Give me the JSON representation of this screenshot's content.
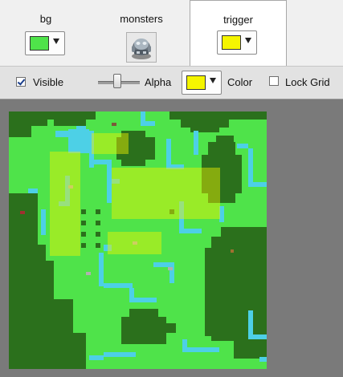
{
  "layers": {
    "tabs": [
      {
        "label": "bg",
        "swatch_color": "#4fe34a",
        "selected": false
      },
      {
        "label": "monsters",
        "icon": "monster-sprite-icon",
        "selected": false
      },
      {
        "label": "trigger",
        "swatch_color": "#f5f500",
        "selected": true
      }
    ]
  },
  "toolbar": {
    "visible_label": "Visible",
    "visible_checked": true,
    "alpha_label": "Alpha",
    "alpha_value": 0.45,
    "color_label": "Color",
    "color_value": "#f5f500",
    "lock_grid_label": "Lock Grid",
    "lock_grid_checked": false
  },
  "map": {
    "colors": {
      "grass": "#4fe34a",
      "forest": "#2b701c",
      "water": "#4dd0e6",
      "trigger": "#f5f500",
      "canvas_bg": "#7a7a7a"
    }
  }
}
